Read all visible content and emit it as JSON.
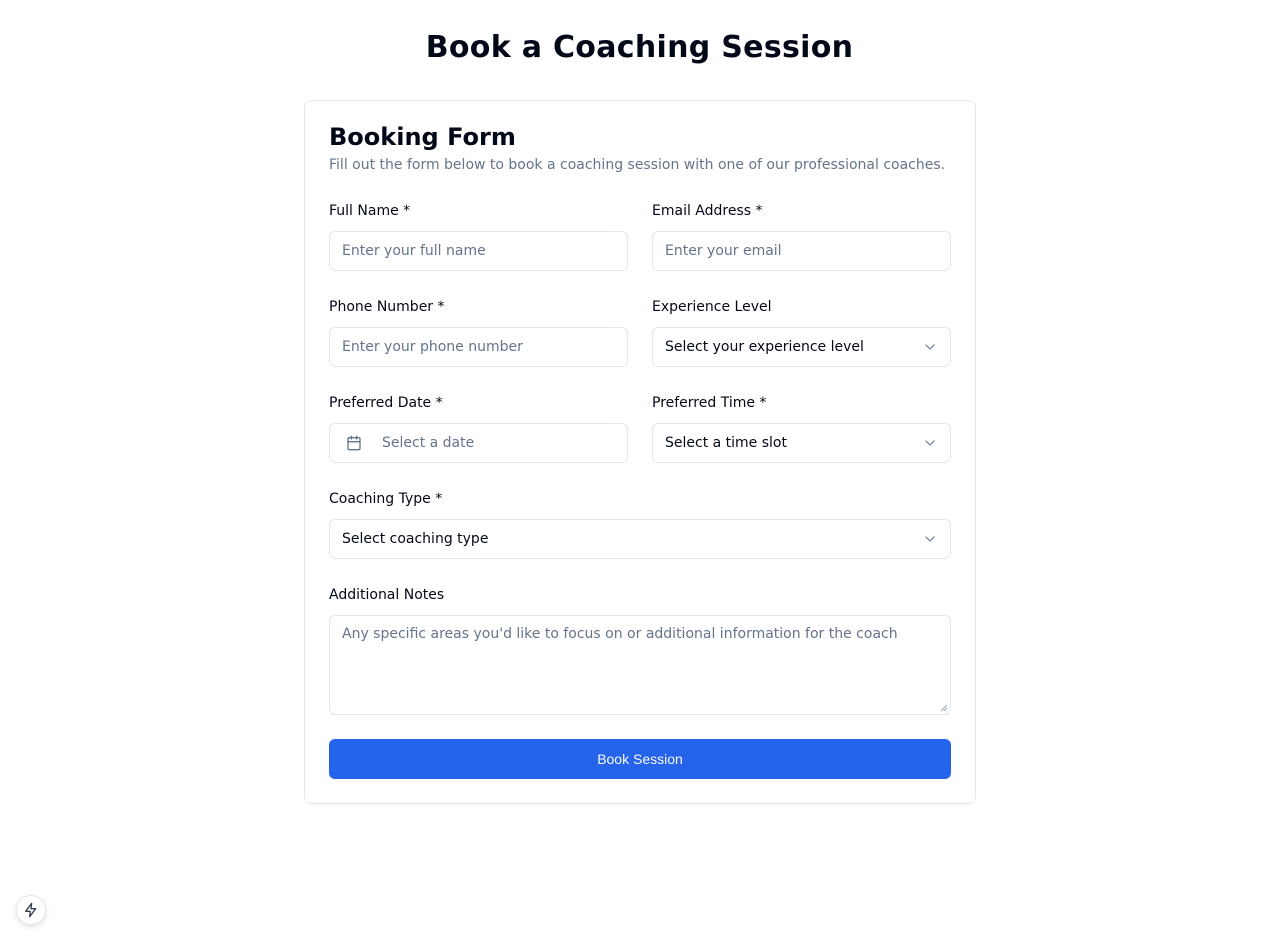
{
  "page": {
    "title": "Book a Coaching Session"
  },
  "form": {
    "title": "Booking Form",
    "description": "Fill out the form below to book a coaching session with one of our professional coaches.",
    "full_name": {
      "label": "Full Name *",
      "placeholder": "Enter your full name"
    },
    "email": {
      "label": "Email Address *",
      "placeholder": "Enter your email"
    },
    "phone": {
      "label": "Phone Number *",
      "placeholder": "Enter your phone number"
    },
    "experience": {
      "label": "Experience Level",
      "value": "Select your experience level"
    },
    "date": {
      "label": "Preferred Date *",
      "placeholder": "Select a date"
    },
    "time": {
      "label": "Preferred Time *",
      "value": "Select a time slot"
    },
    "coaching_type": {
      "label": "Coaching Type *",
      "value": "Select coaching type"
    },
    "notes": {
      "label": "Additional Notes",
      "placeholder": "Any specific areas you'd like to focus on or additional information for the coach"
    },
    "submit_label": "Book Session"
  },
  "colors": {
    "primary": "#2563eb",
    "border": "#e2e8f0",
    "muted": "#64748b"
  },
  "icons": [
    "calendar-icon",
    "chevron-down-icon",
    "lightning-icon"
  ]
}
